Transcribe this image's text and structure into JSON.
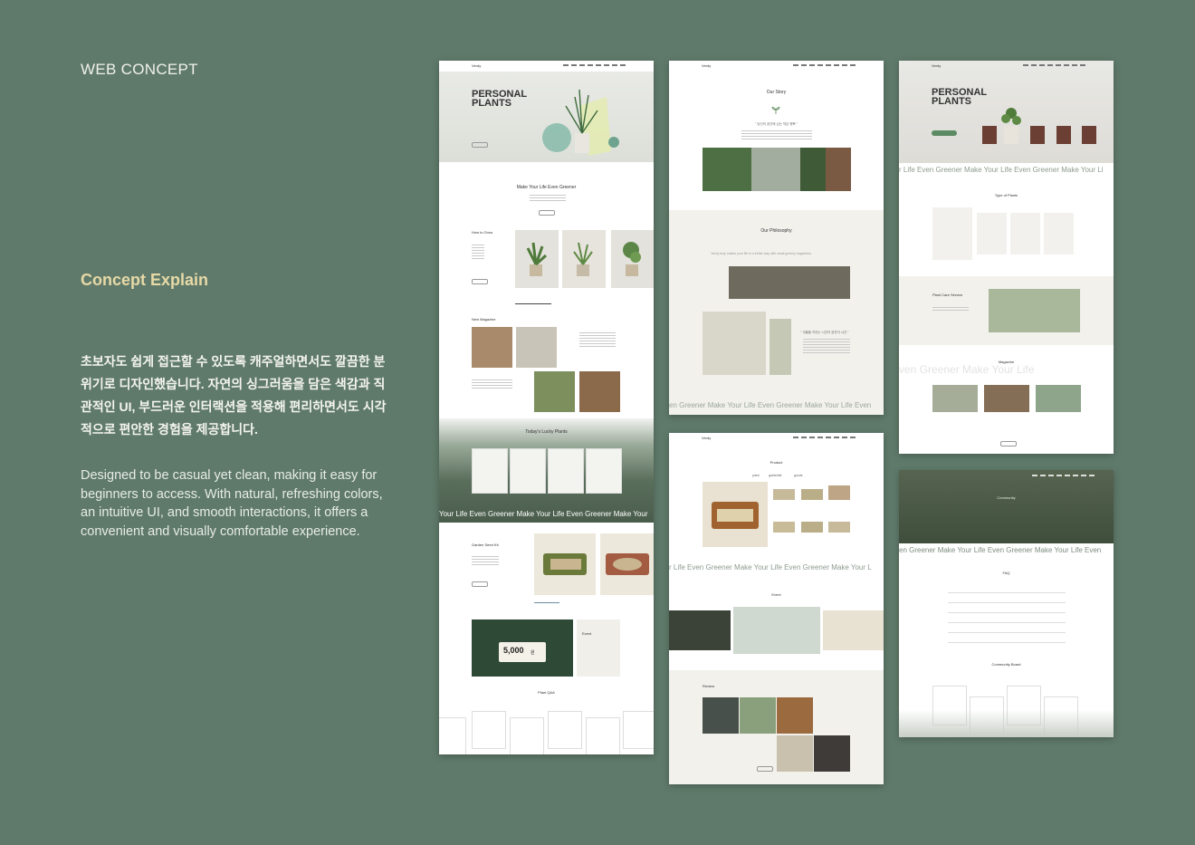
{
  "left": {
    "title": "WEB CONCEPT",
    "subtitle": "Concept Explain",
    "ko_text": "초보자도 쉽게 접근할 수 있도록 캐주얼하면서도 깔끔한 분위기로 디자인했습니다. 자연의 싱그러움을 담은 색감과 직관적인 UI, 부드러운 인터랙션을 적용해 편리하면서도 시각적으로 편안한 경험을 제공합니다.",
    "en_text": "Designed to be casual yet clean, making it easy for beginners to access. With natural, refreshing colors, an intuitive UI, and smooth interactions, it offers a convenient and visually comfortable experience."
  },
  "mock1": {
    "logo": "Verdy",
    "hero_title_1": "PERSONAL",
    "hero_title_2": "PLANTS",
    "tagline": "Make Your Life Even Greener",
    "how_to_grow": "How to Grow",
    "new_magazine": "New Magazine",
    "lucky": "Today's Lucky Plants",
    "marquee": "Your Life Even Greener  Make Your Life Even Greener  Make Your",
    "seed_kit": "Garden Seed Kit",
    "coupon": "5,000",
    "coupon_unit": "원",
    "event": "Event",
    "qa": "Plant Q&A"
  },
  "mock2": {
    "logo": "Verdy",
    "our_story": "Our Story",
    "story_quote": "\" 당신의 공간에 심는 작은 행복 \"",
    "philosophy": "Our Philosophy",
    "philosophy_sub": "Verdy truly makes your life in a better way with small greenly happiness.",
    "quote2": "\" 식물을 키우는 시간이 공간이 시간 \"",
    "marquee": "en Greener  Make Your Life Even Greener  Make Your Life Even"
  },
  "mock3": {
    "logo": "Verdy",
    "hero_title_1": "PERSONAL",
    "hero_title_2": "PLANTS",
    "marquee": "r Life Even Greener  Make Your Life Even Greener  Make Your Li",
    "types": "Type of Plants",
    "care": "Plant Care Service",
    "magazine": "Magazine",
    "outline_marquee": "ven Greener        Make Your Life"
  },
  "mock4": {
    "logo": "Verdy",
    "product": "Product",
    "tabs": [
      "plant",
      "gardenkit",
      "goods"
    ],
    "marquee": "r Life Even Greener  Make Your Life Even Greener  Make Your L",
    "event": "Event",
    "review": "Review"
  },
  "mock5": {
    "community": "Community",
    "marquee": "en Greener  Make Your Life Even Greener  Make Your Life Even",
    "faq": "FAQ",
    "board": "Community Board"
  }
}
